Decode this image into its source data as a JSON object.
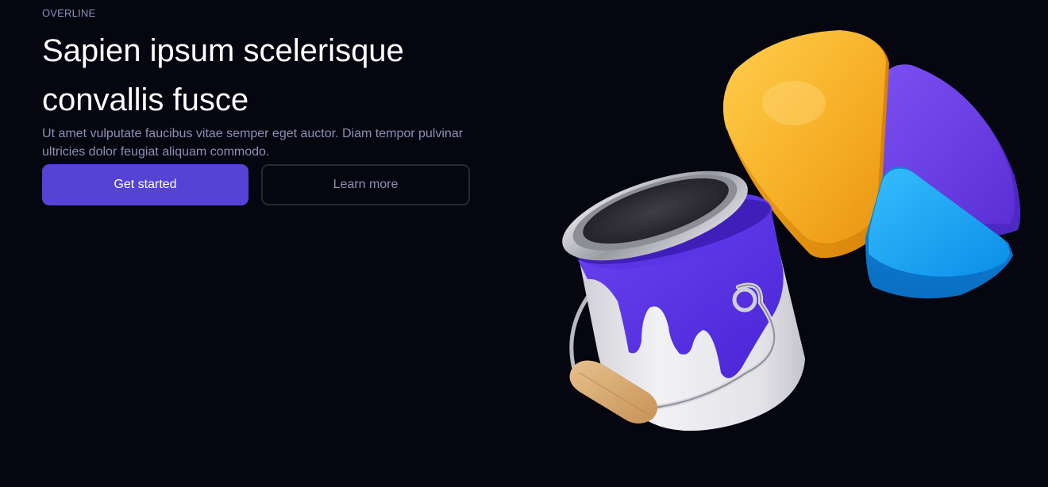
{
  "hero": {
    "overline": "OVERLINE",
    "title": "Sapien ipsum scelerisque convallis fusce",
    "description": "Ut amet vulputate faucibus vitae semper eget auctor. Diam tempor pulvinar ultricies dolor feugiat aliquam commodo.",
    "primary_button": "Get started",
    "secondary_button": "Learn more"
  },
  "illustration": {
    "subject": "paint bucket with pie chart pieces",
    "colors": {
      "background": "#05060f",
      "accent": "#5443d4",
      "yellow": "#f7b52c",
      "purple": "#6a3ee6",
      "blue": "#1aa4f5",
      "paint": "#5a34e8",
      "bucket": "#e4e4e8"
    }
  }
}
